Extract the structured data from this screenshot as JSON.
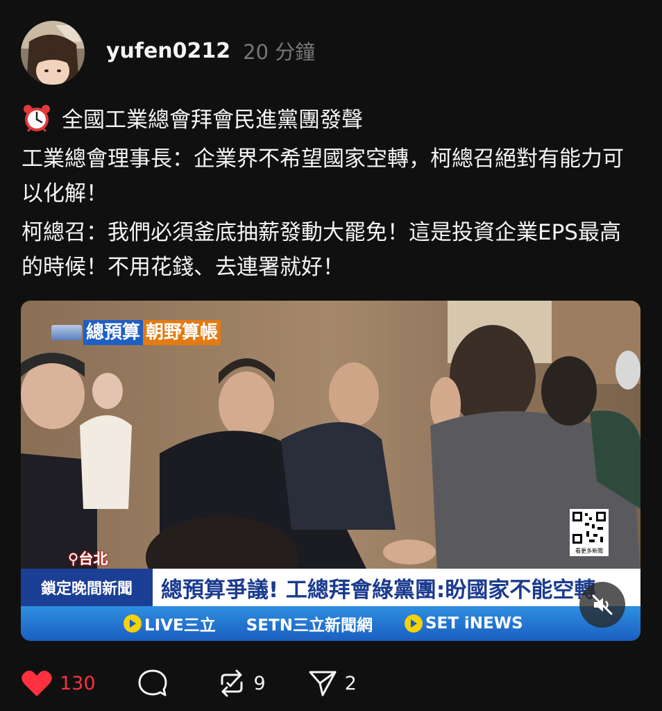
{
  "post": {
    "username": "yufen0212",
    "timestamp": "20 分鐘",
    "avatar_icon": "user-avatar",
    "paragraphs": [
      {
        "icon": "alarm-clock-icon",
        "text": "全國工業總會拜會民進黨團發聲"
      },
      {
        "text": "工業總會理事長：企業界不希望國家空轉，柯總召絕對有能力可以化解！"
      },
      {
        "text": "柯總召：我們必須釜底抽薪發動大罷免！這是投資企業EPS最高的時候！不用花錢、去連署就好！"
      }
    ]
  },
  "video": {
    "logo_part_a": "總預算",
    "logo_part_b": "朝野算帳",
    "location": "台北",
    "program_tag": "鎖定晚間新聞",
    "headline": "總預算爭議! 工總拜會綠黨團:盼國家不能空轉",
    "qr_caption": "看更多新聞",
    "channels": [
      "LIVE三立",
      "SETN三立新聞網",
      "SET iNEWS"
    ],
    "mute_icon": "muted-speaker-icon"
  },
  "actions": {
    "likes": "130",
    "comments": "",
    "reposts": "9",
    "shares": "2"
  },
  "colors": {
    "background": "#101010",
    "text": "#f3f5f7",
    "muted": "#777777",
    "like": "#ff3040"
  }
}
